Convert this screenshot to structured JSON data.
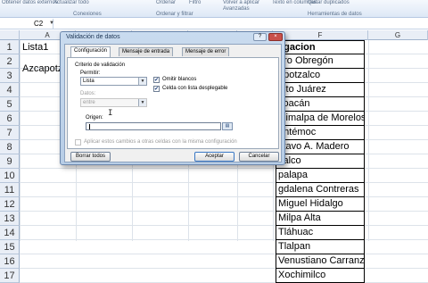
{
  "ribbon": {
    "items": [
      "Obtener datos externos",
      "Actualizar todo",
      "Conexiones",
      "Ordenar",
      "Filtro",
      "Volver a aplicar",
      "Avanzadas",
      "Texto en columnas",
      "Quitar duplicados"
    ],
    "groups": [
      "Conexiones",
      "Ordenar y filtrar",
      "Herramientas de datos"
    ]
  },
  "formula_bar": {
    "name_box": "C2"
  },
  "columns": [
    "A",
    "B",
    "C",
    "D",
    "E",
    "F",
    "G"
  ],
  "rows": [
    "1",
    "2",
    "3",
    "4",
    "5",
    "6",
    "7",
    "8",
    "9",
    "10",
    "11",
    "12",
    "13",
    "14",
    "15",
    "16",
    "17"
  ],
  "cells_a": [
    {
      "row": 1,
      "value": "Lista1"
    },
    {
      "row": 3,
      "value": "Azcapotz"
    }
  ],
  "delegaciones": {
    "header": "egacion",
    "items": [
      "aro Obregón",
      "apotzalco",
      "nito Juárez",
      "yoacán",
      "ajimalpa de Morelos",
      "uhtémoc",
      "stavo A. Madero",
      "calco",
      "palapa",
      "gdalena Contreras",
      "Miguel Hidalgo",
      "Milpa Alta",
      "Tláhuac",
      "Tlalpan",
      "Venustiano Carranza",
      "Xochimilco"
    ]
  },
  "dialog": {
    "title": "Validación de datos",
    "help": "?",
    "close": "×",
    "tabs": [
      "Configuración",
      "Mensaje de entrada",
      "Mensaje de error"
    ],
    "criteria_title": "Criterio de validación",
    "permitir_label": "Permitir:",
    "permitir_value": "Lista",
    "omitir_blancos": "Omitir blancos",
    "celda_lista": "Celda con lista desplegable",
    "datos_label": "Datos:",
    "datos_value": "entre",
    "origen_label": "Origen:",
    "origen_value": "",
    "aplicar_label": "Aplicar estos cambios a otras celdas con la misma configuración",
    "borrar_todos": "Borrar todos",
    "aceptar": "Aceptar",
    "cancelar": "Cancelar"
  }
}
